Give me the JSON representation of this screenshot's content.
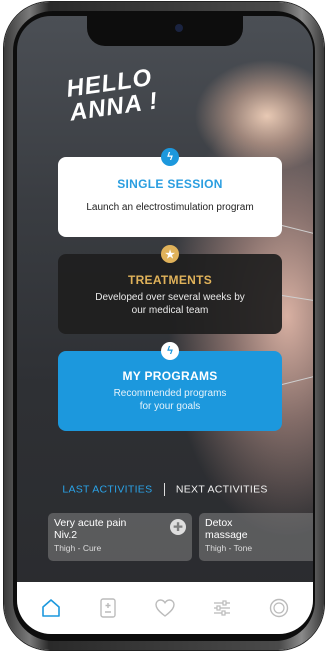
{
  "greeting": {
    "line1": "HELLO",
    "line2": "ANNA !"
  },
  "cards": [
    {
      "title": "SINGLE SESSION",
      "description": "Launch an electrostimulation program",
      "badge_icon": "lightning-icon"
    },
    {
      "title": "TREATMENTS",
      "description_line1": "Developed over several weeks by",
      "description_line2": "our medical team",
      "badge_icon": "star-icon"
    },
    {
      "title": "MY PROGRAMS",
      "description_line1": "Recommended programs",
      "description_line2": "for your goals",
      "badge_icon": "lightning-icon"
    }
  ],
  "activity_tabs": {
    "active": "LAST ACTIVITIES",
    "inactive": "NEXT ACTIVITIES"
  },
  "activities": [
    {
      "title_line1": "Very acute pain",
      "title_line2": "Niv.2",
      "subtitle": "Thigh - Cure"
    },
    {
      "title_line1": "Detox",
      "title_line2": "massage",
      "subtitle": "Thigh - Tone"
    }
  ],
  "nav": [
    "home-icon",
    "calculator-icon",
    "heart-icon",
    "sliders-icon",
    "device-icon"
  ],
  "colors": {
    "accent_blue": "#1c98dd",
    "gold": "#e0b25a",
    "dark_card": "#1e1e1e"
  }
}
